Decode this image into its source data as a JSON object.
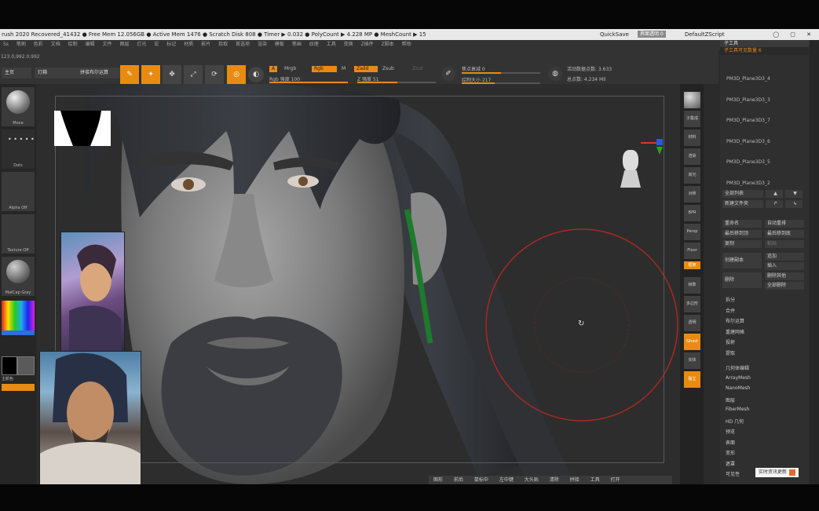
{
  "window": {
    "title_left": "rush 2020   Recovered_41432  ● Free Mem 12.056GB ● Active Mem 1476 ● Scratch Disk 808 ● Timer ▶ 0.032 ● PolyCount ▶ 4.228 MP ● MeshCount ▶ 15",
    "quicksave": "QuickSave",
    "transparency": "界面透明 0",
    "script": "DefaultZScript",
    "controls": "◯ ▢ ✕"
  },
  "menu": [
    "Ss",
    "笔刷",
    "色彩",
    "文档",
    "绘制",
    "编辑",
    "文件",
    "图层",
    "灯光",
    "宏",
    "标记",
    "材质",
    "影片",
    "拾取",
    "首选项",
    "渲染",
    "模板",
    "笔画",
    "纹理",
    "工具",
    "变换",
    "Z插件",
    "Z脚本",
    "帮助"
  ],
  "coords": "123.0,992.0.992",
  "toolbar": {
    "tab_home": "主页",
    "tab_light": "灯箱",
    "tab_boolean": "拼接布尔运算",
    "mrgb": "Mrgb",
    "rgb": "Rgb",
    "m": "M",
    "zadd": "Zadd",
    "zsub": "Zsub",
    "zcut": "Zcut",
    "rgb_strength": "Rgb 强度 100",
    "z_strength": "Z 强度 51",
    "focal": "焦点衰减 0",
    "draw_size": "绘制大小 217",
    "active_points": "活动数据点数: 3.633",
    "total_points": "总点数: 4.234 Mil",
    "a_label": "A"
  },
  "left_shelf": {
    "move": "Move",
    "dots": "Dots",
    "alpha": "Alpha Off",
    "texture": "Texture Off",
    "matcap": "MatCap Gray",
    "color_label": "主颜色"
  },
  "right_column": [
    "子集成",
    "材料",
    "渲染",
    "高光",
    "对称",
    "BPR",
    "Persp",
    "Floor",
    "框架",
    "帧数",
    "多边形",
    "透明",
    "Ghost",
    "实体",
    "独立"
  ],
  "right_panel": {
    "header": "子工具",
    "count": "子工具可见数量 6",
    "subtools": [
      "PM3D_Plane3D3_4",
      "PM3D_Plane3D3_3",
      "PM3D_Plane3D3_7",
      "PM3D_Plane3D3_6",
      "PM3D_Plane3D3_5",
      "PM3D_Plane3D3_2"
    ],
    "all_list": "全部列表",
    "new_folder": "新建文件夹",
    "rename": "重命名",
    "auto_reorder": "自动重排",
    "move_top": "最后移到顶",
    "move_bottom": "最后移到底",
    "copy": "复制",
    "paste": "粘贴",
    "create_dup": "创建副本",
    "append": "追加",
    "insert": "插入",
    "delete": "删除",
    "delete_other": "删除其他",
    "delete_all": "全部删除",
    "items": [
      "拆分",
      "合并",
      "布尔运算",
      "重建网格",
      "投射",
      "提取"
    ],
    "groups": [
      "几何体编辑",
      "ArrayMesh",
      "NanoMesh",
      "图层",
      "FiberMesh",
      "HD 几何",
      "预览",
      "表面",
      "变形",
      "遮罩",
      "可见性"
    ]
  },
  "bottom": [
    "图形",
    "前后",
    "鼠标中",
    "左中键",
    "大头贴",
    "清除",
    "拼接",
    "工具",
    "打开"
  ],
  "watermark": "实时资讯更新",
  "colors": {
    "accent": "#e98b12",
    "panel": "#2f2f2f",
    "viewport": "#2d2d2d"
  }
}
